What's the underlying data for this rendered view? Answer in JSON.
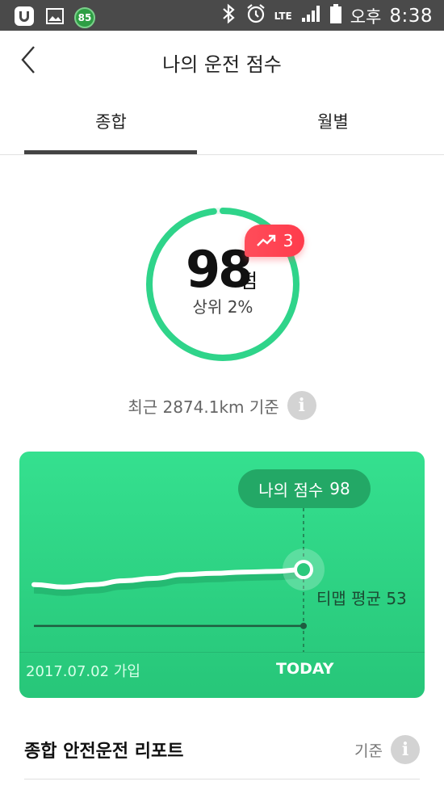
{
  "status_bar": {
    "battery_badge": "85",
    "network": "LTE",
    "ampm": "오후",
    "time": "8:38"
  },
  "header": {
    "title": "나의 운전 점수"
  },
  "tabs": [
    {
      "label": "종합",
      "selected": true
    },
    {
      "label": "월별",
      "selected": false
    }
  ],
  "score": {
    "value": "98",
    "unit": "점",
    "rank": "상위 2%",
    "change": "3",
    "ring_fill": 0.98
  },
  "basis": {
    "text": "최근 2874.1km 기준"
  },
  "chart_card": {
    "my_label": "나의 점수",
    "my_value": "98",
    "avg_label": "티맵 평균 53",
    "start_label": "2017.07.02 가입",
    "end_label": "TODAY"
  },
  "chart_data": {
    "type": "line",
    "series": [
      {
        "values": [
          86,
          84,
          86,
          89,
          91,
          94,
          95,
          96,
          96.5,
          98
        ]
      },
      {
        "values": [
          53,
          53,
          53,
          53,
          53,
          53,
          53,
          53,
          53,
          53
        ]
      }
    ]
  },
  "report": {
    "title": "종합 안전운전 리포트",
    "basis_label": "기준"
  },
  "colors": {
    "accent_green": "#2fd48a",
    "badge_red": "#ff4451"
  }
}
